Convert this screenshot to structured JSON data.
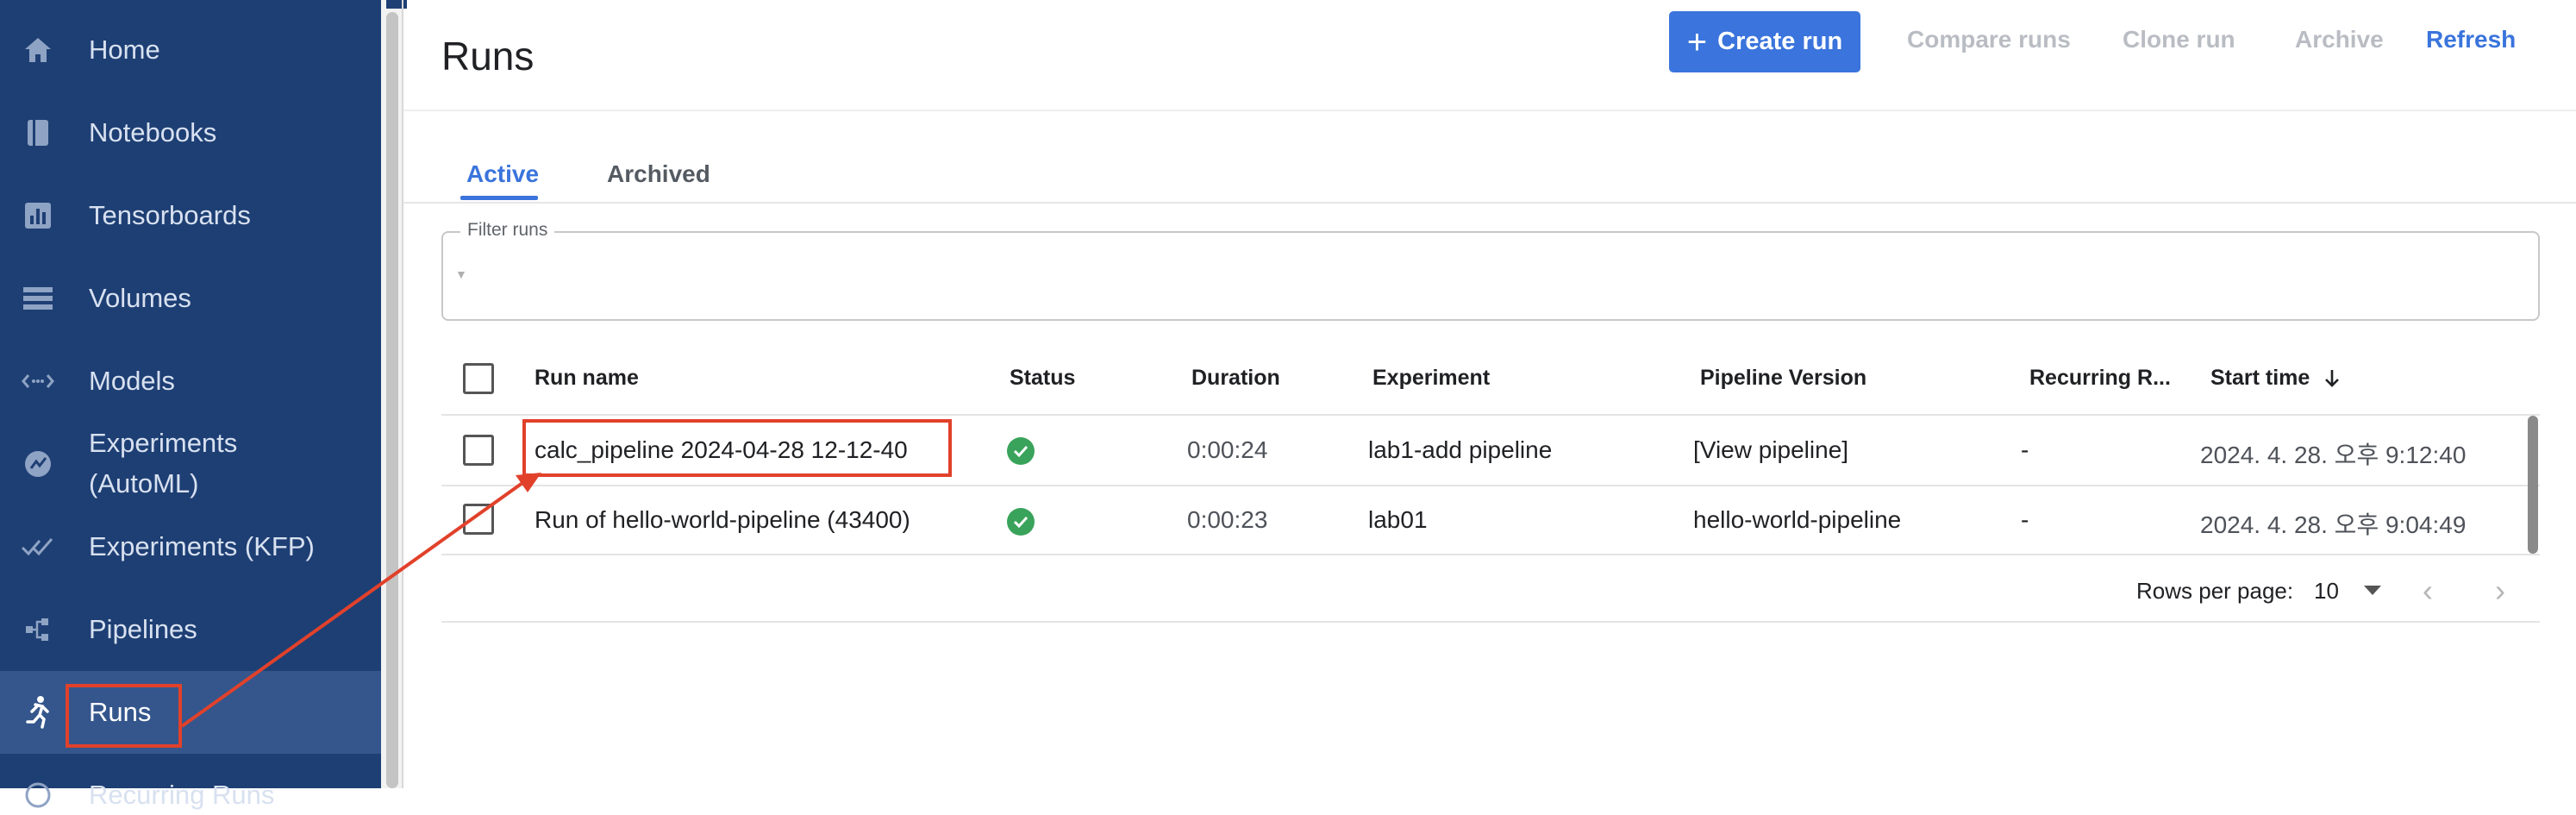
{
  "sidebar": {
    "items": [
      {
        "label": "Home",
        "icon": "home-icon"
      },
      {
        "label": "Notebooks",
        "icon": "notebook-icon"
      },
      {
        "label": "Tensorboards",
        "icon": "bar-chart-icon"
      },
      {
        "label": "Volumes",
        "icon": "storage-icon"
      },
      {
        "label": "Models",
        "icon": "code-arrows-icon"
      },
      {
        "label_line1": "Experiments",
        "label_line2": "(AutoML)",
        "icon": "automl-icon"
      },
      {
        "label": "Experiments (KFP)",
        "icon": "done-all-icon"
      },
      {
        "label": "Pipelines",
        "icon": "pipeline-icon"
      },
      {
        "label": "Runs",
        "icon": "run-icon",
        "active": true
      },
      {
        "label": "Recurring Runs",
        "icon": "recurring-icon"
      }
    ]
  },
  "page": {
    "title": "Runs"
  },
  "toolbar": {
    "create_run": "Create run",
    "compare_runs": "Compare runs",
    "clone_run": "Clone run",
    "archive": "Archive",
    "refresh": "Refresh"
  },
  "tabs": {
    "active": "Active",
    "archived": "Archived"
  },
  "filter": {
    "legend": "Filter runs"
  },
  "table": {
    "headers": {
      "run_name": "Run name",
      "status": "Status",
      "duration": "Duration",
      "experiment": "Experiment",
      "pipeline_version": "Pipeline Version",
      "recurring_run": "Recurring R...",
      "start_time": "Start time"
    },
    "rows": [
      {
        "run_name": "calc_pipeline 2024-04-28 12-12-40",
        "status": "succeeded",
        "duration": "0:00:24",
        "experiment": "lab1-add pipeline",
        "pipeline_version": "[View pipeline]",
        "recurring_run": "-",
        "start_time": "2024. 4. 28. 오후 9:12:40"
      },
      {
        "run_name": "Run of hello-world-pipeline (43400)",
        "status": "succeeded",
        "duration": "0:00:23",
        "experiment": "lab01",
        "pipeline_version": "hello-world-pipeline",
        "recurring_run": "-",
        "start_time": "2024. 4. 28. 오후 9:04:49"
      }
    ]
  },
  "pagination": {
    "rows_per_page_label": "Rows per page:",
    "rows_per_page": "10"
  },
  "colors": {
    "sidebar_bg": "#1e3f74",
    "accent": "#3a74dc",
    "success": "#3aa35b",
    "annotation": "#e1412b"
  }
}
